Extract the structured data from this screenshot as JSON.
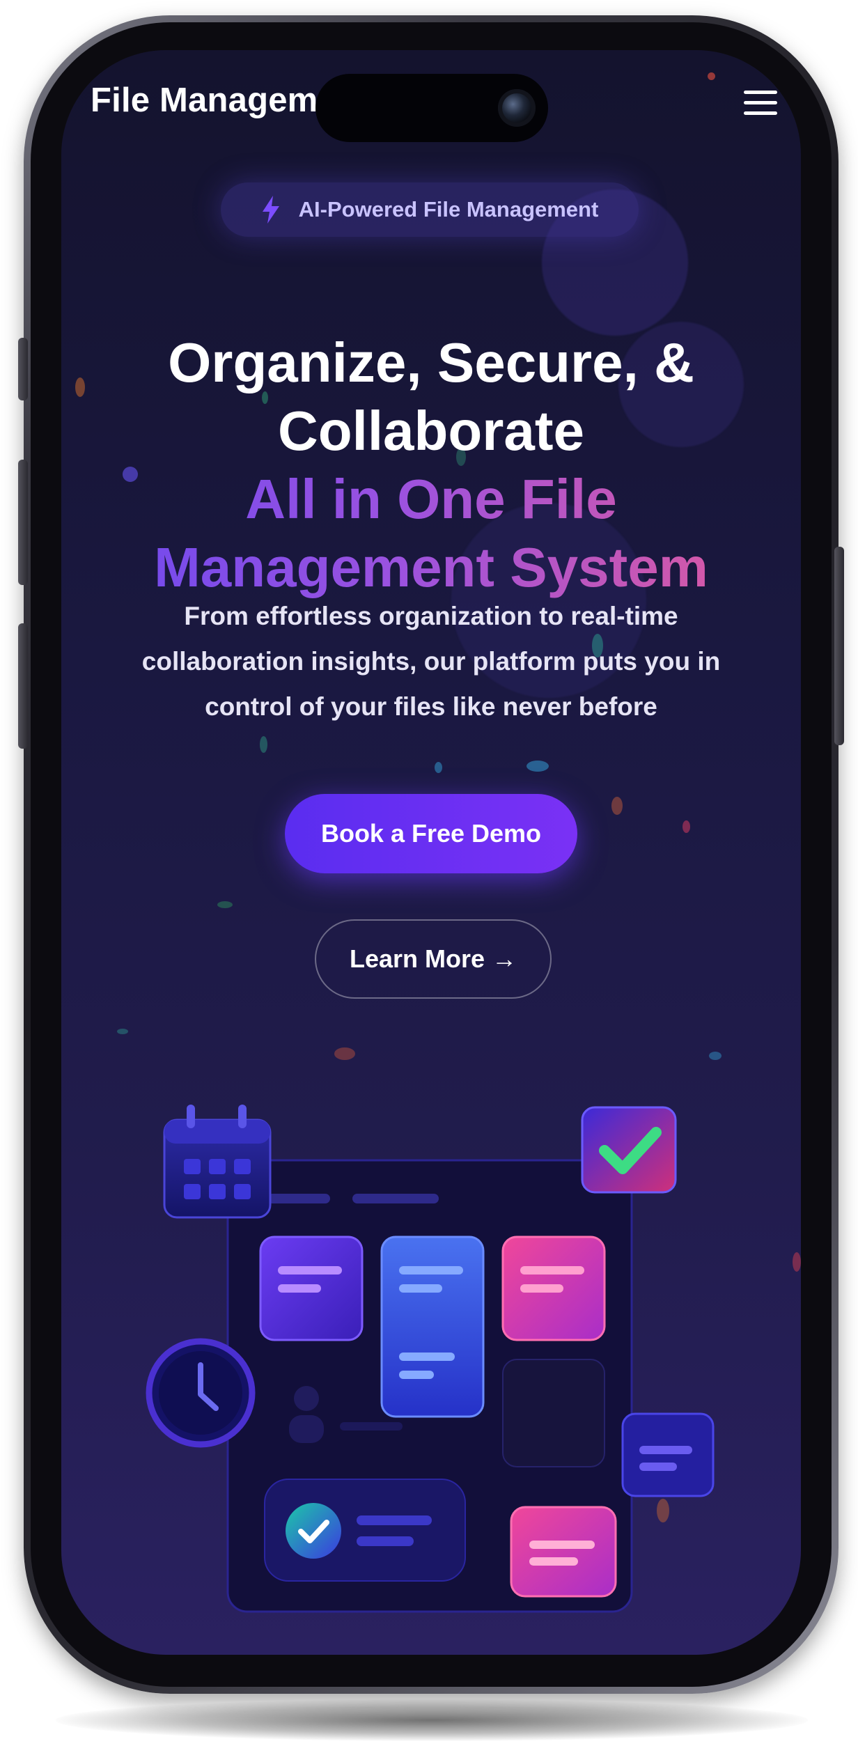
{
  "header": {
    "brand": "File Manageme",
    "menu_icon": "hamburger-menu-icon"
  },
  "hero": {
    "badge": {
      "icon": "lightning-icon",
      "text": "AI-Powered File Management"
    },
    "headline": {
      "line1": "Organize, Secure, &",
      "line2": "Collaborate",
      "line3": "All in One File",
      "line4": "Management System"
    },
    "subcopy": {
      "line1": "From effortless organization to real-time",
      "line2": "collaboration insights, our platform puts you in",
      "line3": "control of your files like never before"
    },
    "primary_cta": "Book a Free Demo",
    "secondary_cta": "Learn More →"
  },
  "illustration": {
    "icons": [
      "calendar-icon",
      "checkmark-icon",
      "clock-icon",
      "check-circle-icon",
      "user-icon"
    ]
  },
  "colors": {
    "background_top": "#14132e",
    "background_bottom": "#2a2160",
    "accent_purple": "#6a48f0",
    "accent_pink": "#e35a9a",
    "check_green": "#3ddc84"
  }
}
